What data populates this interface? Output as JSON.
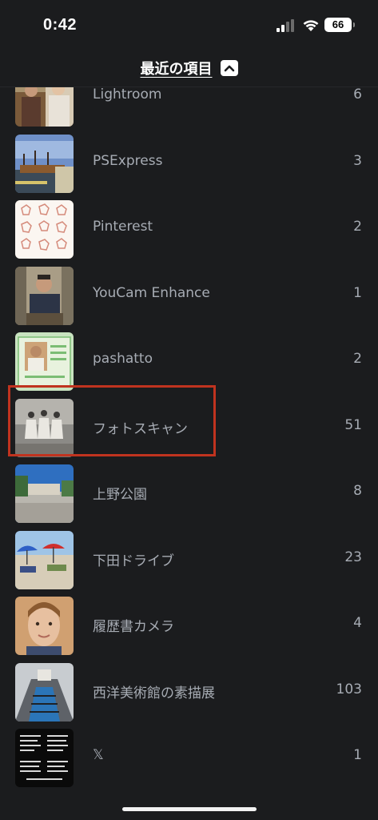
{
  "status_bar": {
    "time": "0:42",
    "battery": "66"
  },
  "header": {
    "title": "最近の項目",
    "toggle_icon": "chevron-up-icon"
  },
  "albums": [
    {
      "name": "Lightroom",
      "count": "6",
      "thumb": "photo-two-people"
    },
    {
      "name": "PSExpress",
      "count": "3",
      "thumb": "photo-ship-harbor"
    },
    {
      "name": "Pinterest",
      "count": "2",
      "thumb": "image-hand-sketches"
    },
    {
      "name": "YouCam Enhance",
      "count": "1",
      "thumb": "photo-seated-man"
    },
    {
      "name": "pashatto",
      "count": "2",
      "thumb": "photo-id-card"
    },
    {
      "name": "フォトスキャン",
      "count": "51",
      "thumb": "photo-three-women"
    },
    {
      "name": "上野公園",
      "count": "8",
      "thumb": "photo-park-building"
    },
    {
      "name": "下田ドライブ",
      "count": "23",
      "thumb": "photo-beach-umbrellas"
    },
    {
      "name": "履歴書カメラ",
      "count": "4",
      "thumb": "photo-boy-portrait"
    },
    {
      "name": "西洋美術館の素描展",
      "count": "103",
      "thumb": "photo-escalator"
    },
    {
      "name": "𝕏",
      "count": "1",
      "thumb": "image-text-document"
    }
  ],
  "colors": {
    "background": "#1b1c1e",
    "text_secondary": "#a7acb4",
    "highlight": "#c0331f"
  }
}
